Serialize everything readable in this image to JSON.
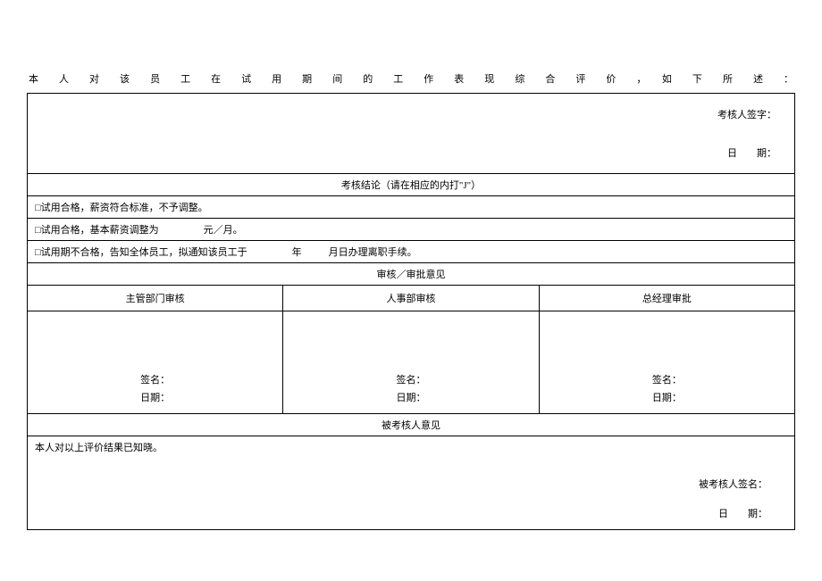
{
  "intro": "本　人　对　该　员　工　在　试　用　期　间　的　工　作　表　现　综　合　评　价　，　如　下　所　述　：",
  "eval": {
    "signLabel": "考核人签字：",
    "dateLabel": "日　　期："
  },
  "conclusion": {
    "header": "考核结论（请在相应的内打\"J\"）",
    "option1": "□试用合格，薪资符合标准，不予调整。",
    "option2_a": "□试用合格，基本薪资调整为",
    "option2_b": "元／月。",
    "option3_a": "□试用期不合格，告知全体员工，拟通知该员工于",
    "option3_b": "年",
    "option3_c": "月日办理离职手续。"
  },
  "approval": {
    "header": "审核／审批意见",
    "col1": "主管部门审核",
    "col2": "人事部审核",
    "col3": "总经理审批",
    "signLabel": "签名：",
    "dateLabel": "日期："
  },
  "reviewed": {
    "header": "被考核人意见",
    "text": "本人对以上评价结果已知晓。",
    "signLabel": "被考核人签名：",
    "dateLabel": "日　　期："
  }
}
